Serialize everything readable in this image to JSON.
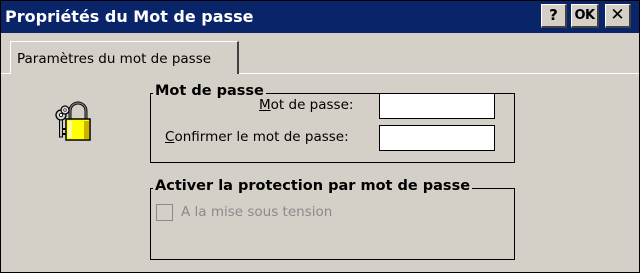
{
  "window": {
    "title": "Propriétés du Mot de passe",
    "help_label": "?",
    "ok_label": "OK",
    "close_label": "✕",
    "title_bar_color": "#0a246a",
    "face_color": "#d4d0c8"
  },
  "tabs": [
    {
      "label": "Paramètres du mot de passe",
      "selected": true
    }
  ],
  "icon": {
    "name": "keys-lock-icon"
  },
  "password_group": {
    "legend": "Mot de passe",
    "password_label_underlined": "M",
    "password_label_rest": "ot de passe:",
    "password_value": "",
    "confirm_label_underlined": "C",
    "confirm_label_rest": "onfirmer le mot de passe:",
    "confirm_value": ""
  },
  "protection_group": {
    "legend": "Activer la protection par mot de passe",
    "checkbox_label": "A la mise sous tension",
    "checkbox_checked": false,
    "checkbox_enabled": false
  }
}
